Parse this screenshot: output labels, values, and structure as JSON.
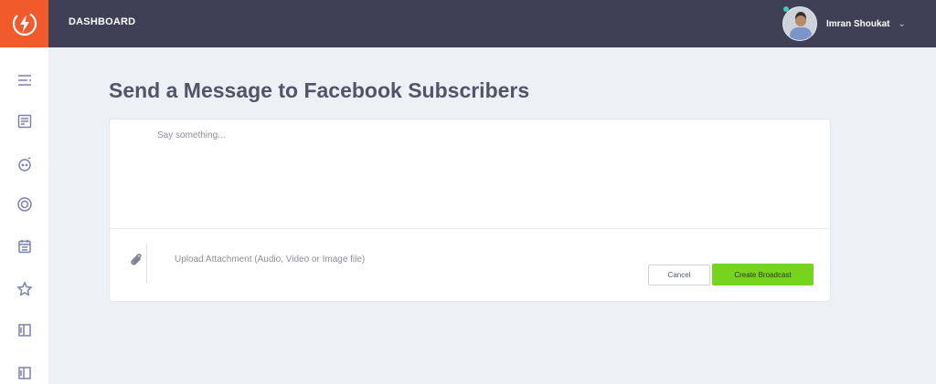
{
  "header": {
    "title": "DASHBOARD",
    "user_name": "Imran Shoukat",
    "logo_icon": "lightning-bolt-icon",
    "status_color": "#35d0b8"
  },
  "sidebar": {
    "items": [
      {
        "icon": "list-icon"
      },
      {
        "icon": "document-icon"
      },
      {
        "icon": "chat-icon"
      },
      {
        "icon": "target-icon"
      },
      {
        "icon": "calendar-icon"
      },
      {
        "icon": "star-icon"
      },
      {
        "icon": "layout-icon"
      },
      {
        "icon": "layout-alt-icon"
      }
    ]
  },
  "main": {
    "page_title": "Send a Message to Facebook Subscribers",
    "message_placeholder": "Say something...",
    "upload_label": "Upload Attachment (Audio, Video or Image file)",
    "cancel_label": "Cancel",
    "create_label": "Create Broadcast"
  },
  "colors": {
    "accent": "#f15a2b",
    "topbar": "#3f3f55",
    "primary_button": "#77d41e",
    "background": "#edf1f6"
  }
}
